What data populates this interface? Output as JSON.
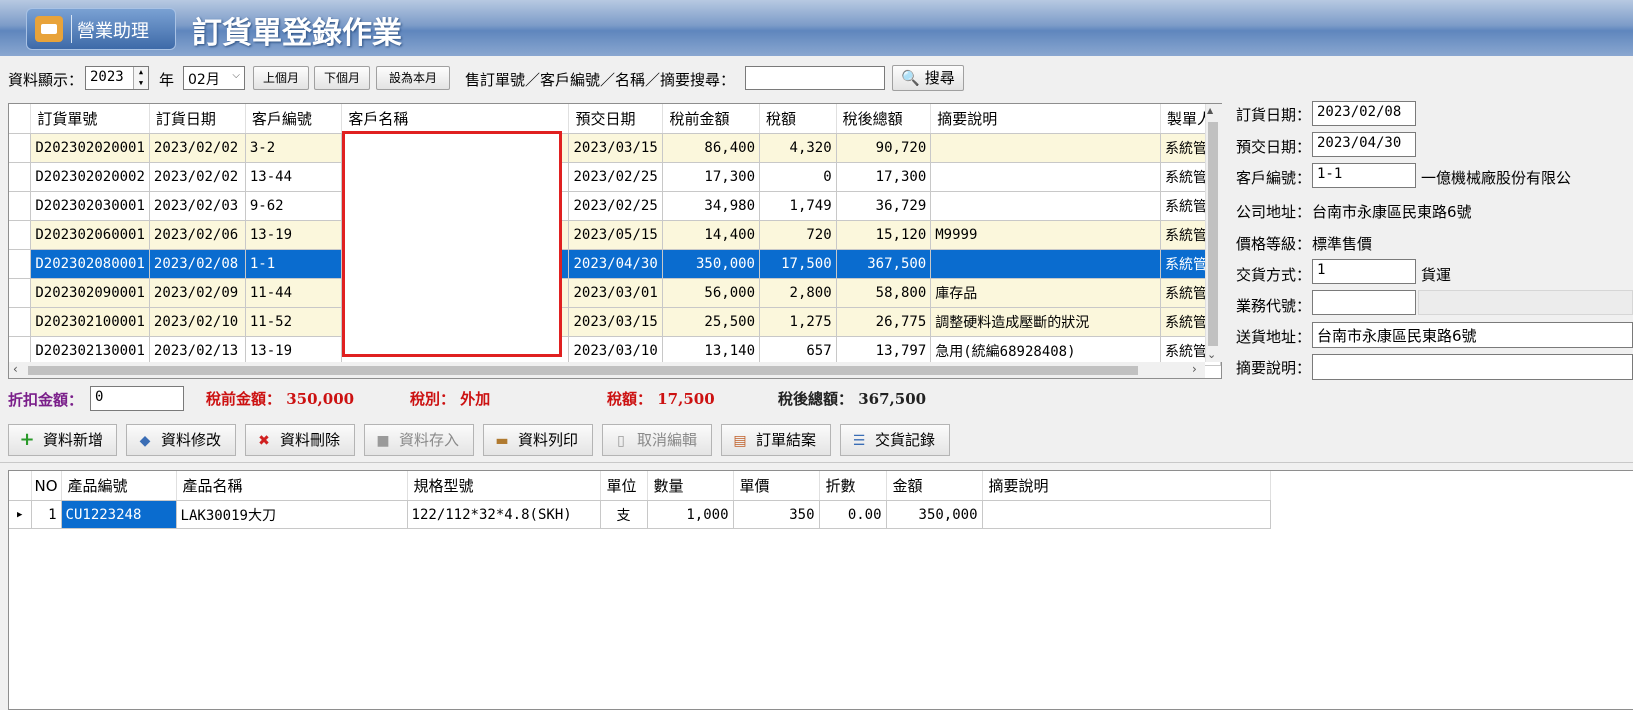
{
  "app": {
    "logo_text": "營業助理",
    "title": "訂貨單登錄作業"
  },
  "filter": {
    "display_label": "資料顯示：",
    "year_value": "2023",
    "year_label": "年",
    "month_value": "02月",
    "prev_month": "上個月",
    "next_month": "下個月",
    "this_month": "設為本月",
    "search_label": "售訂單號／客戶編號／名稱／摘要搜尋：",
    "search_value": "",
    "search_button": "搜尋"
  },
  "orders": {
    "columns": [
      "訂貨單號",
      "訂貨日期",
      "客戶編號",
      "客戶名稱",
      "預交日期",
      "稅前金額",
      "稅額",
      "稅後總額",
      "摘要說明",
      "製單人"
    ],
    "rows": [
      {
        "no": "D202302020001",
        "date": "2023/02/02",
        "cust": "3-2",
        "name": "",
        "due": "2023/03/15",
        "pre": "86,400",
        "tax": "4,320",
        "total": "90,720",
        "memo": "",
        "maker": "系統管"
      },
      {
        "no": "D202302020002",
        "date": "2023/02/02",
        "cust": "13-44",
        "name": "",
        "due": "2023/02/25",
        "pre": "17,300",
        "tax": "0",
        "total": "17,300",
        "memo": "",
        "maker": "系統管"
      },
      {
        "no": "D202302030001",
        "date": "2023/02/03",
        "cust": "9-62",
        "name": "",
        "due": "2023/02/25",
        "pre": "34,980",
        "tax": "1,749",
        "total": "36,729",
        "memo": "",
        "maker": "系統管"
      },
      {
        "no": "D202302060001",
        "date": "2023/02/06",
        "cust": "13-19",
        "name": "",
        "due": "2023/05/15",
        "pre": "14,400",
        "tax": "720",
        "total": "15,120",
        "memo": "M9999",
        "maker": "系統管"
      },
      {
        "no": "D202302080001",
        "date": "2023/02/08",
        "cust": "1-1",
        "name": "",
        "due": "2023/04/30",
        "pre": "350,000",
        "tax": "17,500",
        "total": "367,500",
        "memo": "",
        "maker": "系統管"
      },
      {
        "no": "D202302090001",
        "date": "2023/02/09",
        "cust": "11-44",
        "name": "",
        "due": "2023/03/01",
        "pre": "56,000",
        "tax": "2,800",
        "total": "58,800",
        "memo": "庫存品",
        "maker": "系統管"
      },
      {
        "no": "D202302100001",
        "date": "2023/02/10",
        "cust": "11-52",
        "name": "",
        "due": "2023/03/15",
        "pre": "25,500",
        "tax": "1,275",
        "total": "26,775",
        "memo": "調整硬料造成壓斷的狀況",
        "maker": "系統管"
      },
      {
        "no": "D202302130001",
        "date": "2023/02/13",
        "cust": "13-19",
        "name": "",
        "due": "2023/03/10",
        "pre": "13,140",
        "tax": "657",
        "total": "13,797",
        "memo": "急用(統編68928408)",
        "maker": "系統管"
      }
    ],
    "selected_index": 4
  },
  "totals": {
    "discount_label": "折扣金額：",
    "discount_value": "0",
    "pre_tax_label": "稅前金額：",
    "pre_tax_value": "350,000",
    "tax_type_label": "稅別：",
    "tax_type_value": "外加",
    "tax_label": "稅額：",
    "tax_value": "17,500",
    "after_tax_label": "稅後總額：",
    "after_tax_value": "367,500"
  },
  "detail": {
    "order_date_label": "訂貨日期：",
    "order_date": "2023/02/08",
    "due_date_label": "預交日期：",
    "due_date": "2023/04/30",
    "cust_no_label": "客戶編號：",
    "cust_no": "1-1",
    "cust_name": "一億機械廠股份有限公",
    "address_label": "公司地址：",
    "address": "台南市永康區民東路6號",
    "price_level_label": "價格等級：",
    "price_level": "標準售價",
    "delivery_label": "交貨方式：",
    "delivery_code": "1",
    "delivery_name": "貨運",
    "sales_label": "業務代號：",
    "sales_code": "",
    "ship_addr_label": "送貨地址：",
    "ship_addr": "台南市永康區民東路6號",
    "memo_label": "摘要說明：",
    "memo": ""
  },
  "actions": {
    "add": "資料新增",
    "edit": "資料修改",
    "delete": "資料刪除",
    "save": "資料存入",
    "print": "資料列印",
    "cancel": "取消編輯",
    "close_order": "訂單結案",
    "delivery_record": "交貨記錄"
  },
  "items": {
    "columns": [
      "NO",
      "產品編號",
      "產品名稱",
      "規格型號",
      "單位",
      "數量",
      "單價",
      "折數",
      "金額",
      "摘要說明"
    ],
    "rows": [
      {
        "no": "1",
        "code": "CU1223248",
        "name": "LAK30019大刀",
        "spec": "122/112*32*4.8(SKH)",
        "unit": "支",
        "qty": "1,000",
        "price": "350",
        "disc": "0.00",
        "amount": "350,000",
        "memo": ""
      }
    ]
  },
  "colors": {
    "selection": "#0a6ccf",
    "alt_row": "#fbf7dc",
    "total_red": "#cc1111",
    "discount_purple": "#7a1f8a"
  }
}
